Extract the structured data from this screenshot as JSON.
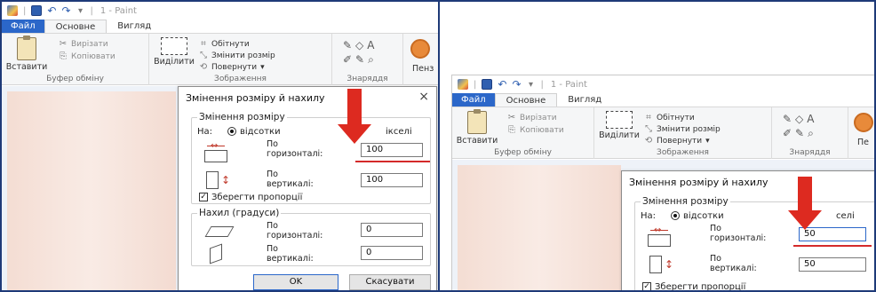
{
  "app": {
    "title": "1 - Paint",
    "title_sep": "|"
  },
  "tabs": {
    "file": "Файл",
    "home": "Основне",
    "view": "Вигляд"
  },
  "ribbon": {
    "paste": "Вставити",
    "cut": "Вирізати",
    "copy": "Копіювати",
    "clipboard_group": "Буфер обміну",
    "select": "Виділити",
    "crop": "Обітнути",
    "resize": "Змінити розмір",
    "rotate": "Повернути",
    "image_group": "Зображення",
    "tools_group": "Знаряддя",
    "shapes_cut": "Пенз",
    "shapes_cut_right": "Пе"
  },
  "dialog": {
    "title": "Змінення розміру й нахилу",
    "close": "×",
    "resize_section": "Змінення розміру",
    "by": "На:",
    "percent": "відсотки",
    "pixels_left": "ікселі",
    "pixels_right": "селі",
    "horizontal_1": "По",
    "horizontal_2": "горизонталі:",
    "vertical_1": "По",
    "vertical_2": "вертикалі:",
    "keep_ratio": "Зберегти пропорції",
    "skew_section": "Нахил (градуси)",
    "ok": "OK",
    "cancel": "Скасувати",
    "checkmark": "✓"
  },
  "left_panel": {
    "horizontal_value": "100",
    "vertical_value": "100",
    "skew_horizontal": "0",
    "skew_vertical": "0"
  },
  "right_panel": {
    "horizontal_value": "50",
    "vertical_value": "50"
  },
  "icons": {
    "undo": "↶",
    "redo": "↷",
    "dropdown": "▾",
    "scissors": "✂",
    "copy": "⎘",
    "crop": "⌗",
    "resize": "⤡",
    "rotate": "⟲",
    "tools": "✎◇A",
    "tools_row2": "✐✎⌕",
    "ribbon_tools_right": "✎◇A",
    "ribbon_tools_right_row2": "✐✎⌕"
  },
  "colors": {
    "arrow": "#dd2a20",
    "file_tab": "#2b67c9",
    "frame": "#1e3a78"
  }
}
